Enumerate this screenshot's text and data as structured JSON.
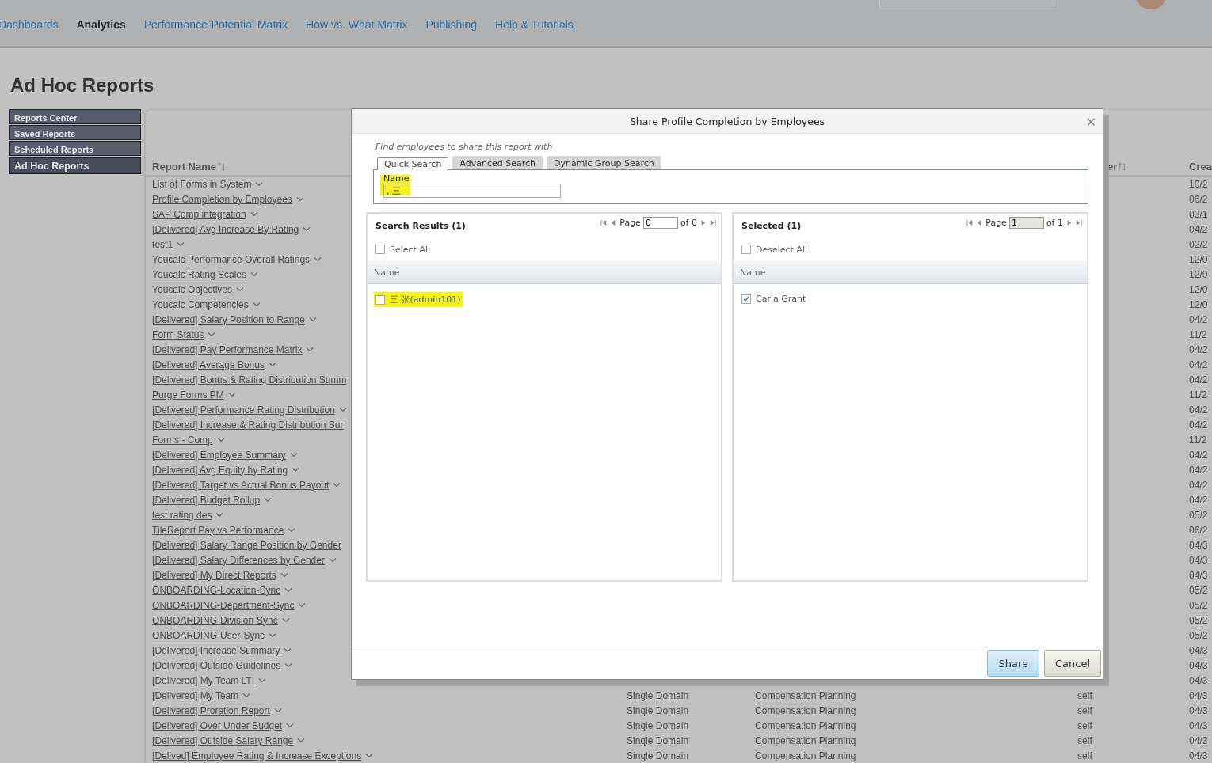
{
  "nav": {
    "items": [
      {
        "label": "Dashboards",
        "selected": false
      },
      {
        "label": "Analytics",
        "selected": true
      },
      {
        "label": "Performance-Potential Matrix",
        "selected": false
      },
      {
        "label": "How vs. What Matrix",
        "selected": false
      },
      {
        "label": "Publishing",
        "selected": false
      },
      {
        "label": "Help & Tutorials",
        "selected": false
      }
    ]
  },
  "page_title": "Ad Hoc Reports",
  "sidebar": {
    "items": [
      {
        "label": "Reports Center",
        "selected": false
      },
      {
        "label": "Saved Reports",
        "selected": false
      },
      {
        "label": "Scheduled Reports",
        "selected": false
      },
      {
        "label": "Ad Hoc Reports",
        "selected": true
      }
    ]
  },
  "table": {
    "header": {
      "report_name": "Report Name",
      "column_4": "er",
      "column_5": "Crea"
    },
    "rows": [
      {
        "name": "List of Forms in System",
        "linked": false,
        "chevron": true,
        "created": "10/2"
      },
      {
        "name": "Profile Completion by Employees",
        "linked": true,
        "chevron": true,
        "created": "06/2"
      },
      {
        "name": "SAP Comp integration",
        "linked": true,
        "chevron": true,
        "created": "03/1"
      },
      {
        "name": "[Delivered] Avg Increase By Rating",
        "linked": true,
        "chevron": true,
        "created": "04/2"
      },
      {
        "name": "test1",
        "linked": true,
        "chevron": true,
        "created": "02/2"
      },
      {
        "name": "Youcalc Performance Overall Ratings",
        "linked": true,
        "chevron": true,
        "created": "12/0"
      },
      {
        "name": "Youcalc Rating Scales",
        "linked": true,
        "chevron": true,
        "created": "12/0"
      },
      {
        "name": "Youcalc Objectives",
        "linked": true,
        "chevron": true,
        "created": "12/0"
      },
      {
        "name": "Youcalc Competencies",
        "linked": true,
        "chevron": true,
        "created": "12/0"
      },
      {
        "name": "[Delivered] Salary Position to Range",
        "linked": true,
        "chevron": true,
        "created": "04/2"
      },
      {
        "name": "Form Status",
        "linked": true,
        "chevron": true,
        "created": "11/2"
      },
      {
        "name": "[Delivered] Pay  Performance Matrix",
        "linked": true,
        "chevron": true,
        "created": "04/2"
      },
      {
        "name": "[Delivered] Average Bonus",
        "linked": true,
        "chevron": true,
        "created": "04/2"
      },
      {
        "name": "[Delivered] Bonus & Rating Distribution Summ",
        "linked": true,
        "chevron": false,
        "created": "04/2"
      },
      {
        "name": "Purge Forms PM",
        "linked": true,
        "chevron": true,
        "created": "11/2"
      },
      {
        "name": "[Delivered] Performance Rating Distribution",
        "linked": true,
        "chevron": true,
        "created": "04/2"
      },
      {
        "name": "[Delivered] Increase & Rating Distribution Sur",
        "linked": true,
        "chevron": false,
        "created": "04/2"
      },
      {
        "name": "Forms - Comp",
        "linked": true,
        "chevron": true,
        "created": "11/2"
      },
      {
        "name": "[Delivered] Employee Summary",
        "linked": true,
        "chevron": true,
        "created": "04/2"
      },
      {
        "name": "[Delivered] Avg Equity by Rating",
        "linked": true,
        "chevron": true,
        "created": "04/2"
      },
      {
        "name": "[Delivered] Target vs Actual Bonus Payout",
        "linked": true,
        "chevron": true,
        "created": "04/2"
      },
      {
        "name": "[Delivered] Budget Rollup",
        "linked": true,
        "chevron": true,
        "created": "04/2"
      },
      {
        "name": "test rating des",
        "linked": true,
        "chevron": true,
        "created": "05/2"
      },
      {
        "name": "TileReport Pay vs Performance",
        "linked": true,
        "chevron": true,
        "created": "06/2"
      },
      {
        "name": "[Delivered] Salary Range Position by Gender",
        "linked": true,
        "chevron": false,
        "created": "04/3"
      },
      {
        "name": "[Delivered] Salary Differences by Gender",
        "linked": true,
        "chevron": true,
        "created": "04/3"
      },
      {
        "name": "[Delivered] My Direct Reports",
        "linked": true,
        "chevron": true,
        "created": "04/3"
      },
      {
        "name": "ONBOARDING-Location-Sync",
        "linked": true,
        "chevron": true,
        "created": "05/2"
      },
      {
        "name": "ONBOARDING-Department-Sync",
        "linked": true,
        "chevron": true,
        "created": "05/2"
      },
      {
        "name": "ONBOARDING-Division-Sync",
        "linked": true,
        "chevron": true,
        "created": "05/2"
      },
      {
        "name": "ONBOARDING-User-Sync",
        "linked": true,
        "chevron": true,
        "created": "05/2"
      },
      {
        "name": "[Delivered] Increase Summary",
        "linked": true,
        "chevron": true,
        "created": "04/3"
      },
      {
        "name": "[Delivered] Outside Guidelines",
        "linked": true,
        "chevron": true,
        "created": "04/3"
      },
      {
        "name": "[Delivered] My Team LTI",
        "linked": true,
        "chevron": true,
        "created": "04/3"
      },
      {
        "name": "[Delivered] My Team",
        "linked": true,
        "chevron": true,
        "type": "Single Domain",
        "category": "Compensation Planning",
        "owner": "self",
        "created": "04/3"
      },
      {
        "name": "[Delivered] Proration Report",
        "linked": true,
        "chevron": true,
        "type": "Single Domain",
        "category": "Compensation Planning",
        "owner": "self",
        "created": "04/3"
      },
      {
        "name": "[Delivered] Over  Under Budget",
        "linked": true,
        "chevron": true,
        "type": "Single Domain",
        "category": "Compensation Planning",
        "owner": "self",
        "created": "04/3"
      },
      {
        "name": "[Delivered] Outside Salary Range",
        "linked": true,
        "chevron": true,
        "type": "Single Domain",
        "category": "Compensation Planning",
        "owner": "self",
        "created": "04/3"
      },
      {
        "name": "[Delived] Employee Rating & Increase Exceptions",
        "linked": true,
        "chevron": true,
        "type": "Single Domain",
        "category": "Compensation Planning",
        "owner": "self",
        "created": "04/3"
      }
    ]
  },
  "modal": {
    "title": "Share Profile Completion by Employees",
    "close": "×",
    "hint": "Find employees to share this report with",
    "tabs": [
      {
        "label": "Quick Search",
        "selected": true
      },
      {
        "label": "Advanced Search",
        "selected": false
      },
      {
        "label": "Dynamic Group Search",
        "selected": false
      }
    ],
    "search": {
      "label": "Name",
      "value": ", 三",
      "highlighted": true
    },
    "panels": [
      {
        "title": "Search Results (1)",
        "page_label": "Page",
        "page": "0",
        "disabled": false,
        "of": "of 0",
        "select_all": {
          "label": "Select All",
          "checked": false
        },
        "column": "Name",
        "items": [
          {
            "label": "三 张(admin101)",
            "checked": false,
            "highlighted": true
          }
        ]
      },
      {
        "title": "Selected (1)",
        "page_label": "Page",
        "page": "1",
        "disabled": true,
        "of": "of 1",
        "select_all": {
          "label": "Deselect All",
          "checked": false
        },
        "column": "Name",
        "items": [
          {
            "label": "Carla Grant",
            "checked": true,
            "highlighted": false
          }
        ]
      }
    ],
    "buttons": [
      {
        "label": "Share",
        "kind": "primary"
      },
      {
        "label": "Cancel",
        "kind": "secondary"
      }
    ]
  }
}
